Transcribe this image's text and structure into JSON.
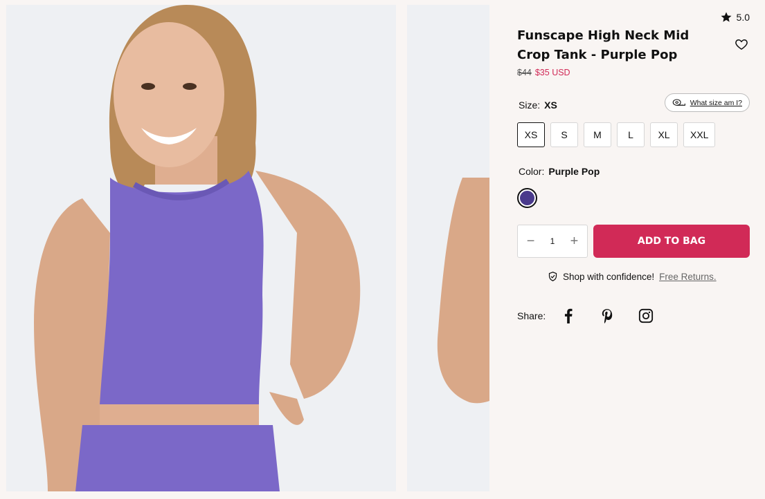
{
  "rating": {
    "value": "5.0",
    "icon": "star-icon"
  },
  "product": {
    "title": "Funscape High Neck Mid Crop Tank - Purple Pop",
    "price_original": "$44",
    "price_sale": "$35 USD"
  },
  "size": {
    "label": "Size:",
    "selected": "XS",
    "guide_label": "What size am I?",
    "options": [
      "XS",
      "S",
      "M",
      "L",
      "XL",
      "XXL"
    ]
  },
  "color": {
    "label": "Color:",
    "selected": "Purple Pop",
    "swatch_hex": "#4a3a8c"
  },
  "quantity": {
    "value": "1",
    "decrement": "−",
    "increment": "+"
  },
  "cart": {
    "add_label": "ADD TO BAG"
  },
  "confidence": {
    "text": "Shop with confidence!",
    "link": "Free Returns."
  },
  "share": {
    "label": "Share:",
    "networks": [
      "facebook",
      "pinterest",
      "instagram"
    ]
  },
  "colors": {
    "accent": "#d12a57",
    "background": "#f9f5f3",
    "product": "#7b68c8"
  }
}
